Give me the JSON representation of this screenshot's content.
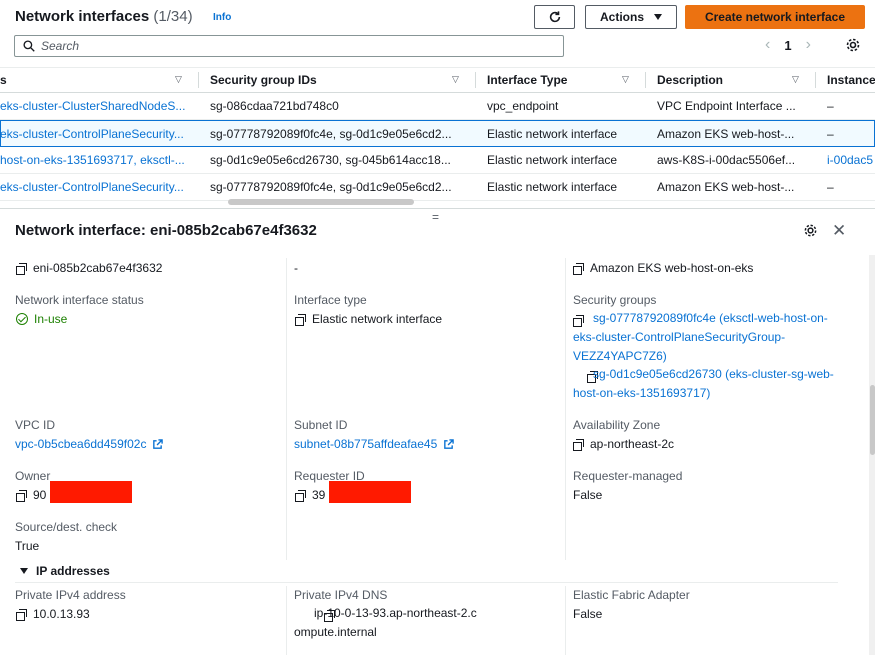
{
  "header": {
    "title": "Network interfaces",
    "count": "(1/34)",
    "info": "Info",
    "actions_label": "Actions",
    "create_label": "Create network interface"
  },
  "search": {
    "placeholder": "Search"
  },
  "pagination": {
    "page": "1"
  },
  "table": {
    "columns": [
      "s",
      "Security group IDs",
      "Interface Type",
      "Description",
      "Instance"
    ],
    "rows": [
      [
        "eks-cluster-ClusterSharedNodeS...",
        "sg-086cdaa721bd748c0",
        "vpc_endpoint",
        "VPC Endpoint Interface ...",
        "–"
      ],
      [
        "eks-cluster-ControlPlaneSecurity...",
        "sg-07778792089f0fc4e, sg-0d1c9e05e6cd2...",
        "Elastic network interface",
        "Amazon EKS web-host-...",
        "–"
      ],
      [
        "host-on-eks-1351693717, eksctl-...",
        "sg-0d1c9e05e6cd26730, sg-045b614acc18...",
        "Elastic network interface",
        "aws-K8S-i-00dac5506ef...",
        "i-00dac5"
      ],
      [
        "eks-cluster-ControlPlaneSecurity...",
        "sg-07778792089f0fc4e, sg-0d1c9e05e6cd2...",
        "Elastic network interface",
        "Amazon EKS web-host-...",
        "–"
      ]
    ]
  },
  "detail": {
    "title": "Network interface: eni-085b2cab67e4f3632",
    "eni_id": "eni-085b2cab67e4f3632",
    "col2_top": "-",
    "description": "Amazon EKS web-host-on-eks",
    "status_label": "Network interface status",
    "status_value": "In-use",
    "interface_type_label": "Interface type",
    "interface_type_value": "Elastic network interface",
    "security_groups_label": "Security groups",
    "security_groups": [
      "sg-07778792089f0fc4e (eksctl-web-host-on-eks-cluster-ControlPlaneSecurityGroup-VEZZ4YAPC7Z6)",
      "sg-0d1c9e05e6cd26730 (eks-cluster-sg-web-host-on-eks-1351693717)"
    ],
    "vpc_label": "VPC ID",
    "vpc_value": "vpc-0b5cbea6dd459f02c",
    "subnet_label": "Subnet ID",
    "subnet_value": "subnet-08b775affdeafae45",
    "az_label": "Availability Zone",
    "az_value": "ap-northeast-2c",
    "owner_label": "Owner",
    "owner_value": "90",
    "requester_label": "Requester ID",
    "requester_value": "39",
    "requester_managed_label": "Requester-managed",
    "requester_managed_value": "False",
    "source_dest_label": "Source/dest. check",
    "source_dest_value": "True",
    "ip_section": "IP addresses",
    "private_ip_label": "Private IPv4 address",
    "private_ip_value": "10.0.13.93",
    "private_dns_label": "Private IPv4 DNS",
    "private_dns_value": "ip-10-0-13-93.ap-northeast-2.compute.internal",
    "efa_label": "Elastic Fabric Adapter",
    "efa_value": "False"
  },
  "colors": {
    "accent_link": "#0972d3",
    "primary_button": "#ec7211",
    "status_green": "#1d8102",
    "redaction": "#ff1a00"
  },
  "icons": [
    "refresh-icon",
    "caret-down-icon",
    "search-icon",
    "chevron-left-icon",
    "chevron-right-icon",
    "settings-gear-icon",
    "sort-caret-icon",
    "drag-handle-icon",
    "close-icon",
    "copy-icon",
    "external-link-icon",
    "check-circle-icon",
    "expand-triangle-icon"
  ]
}
